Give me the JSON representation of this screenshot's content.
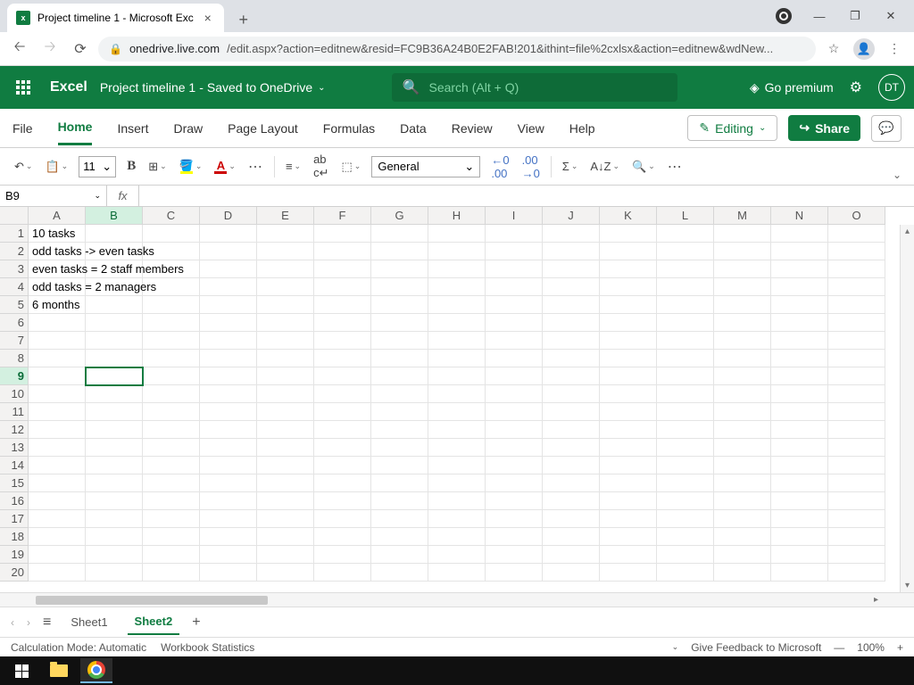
{
  "browser": {
    "tab_title": "Project timeline 1 - Microsoft Exc",
    "url_host": "onedrive.live.com",
    "url_path": "/edit.aspx?action=editnew&resid=FC9B36A24B0E2FAB!201&ithint=file%2cxlsx&action=editnew&wdNew..."
  },
  "header": {
    "app": "Excel",
    "doc_title": "Project timeline 1",
    "save_status": "Saved to OneDrive",
    "search_placeholder": "Search (Alt + Q)",
    "premium": "Go premium",
    "user_initials": "DT"
  },
  "ribbon": {
    "tabs": [
      "File",
      "Home",
      "Insert",
      "Draw",
      "Page Layout",
      "Formulas",
      "Data",
      "Review",
      "View",
      "Help"
    ],
    "active_tab": "Home",
    "editing_label": "Editing",
    "share_label": "Share",
    "font_size": "11",
    "number_format": "General"
  },
  "formula": {
    "name_box": "B9",
    "fx": ""
  },
  "grid": {
    "columns": [
      "A",
      "B",
      "C",
      "D",
      "E",
      "F",
      "G",
      "H",
      "I",
      "J",
      "K",
      "L",
      "M",
      "N",
      "O"
    ],
    "rows": 20,
    "selected": {
      "row": 9,
      "col": "B"
    },
    "cells": {
      "A1": "10 tasks",
      "A2": "odd tasks -> even tasks",
      "A3": "even tasks = 2 staff members",
      "A4": "odd tasks = 2 managers",
      "A5": "6 months"
    }
  },
  "sheets": {
    "tabs": [
      "Sheet1",
      "Sheet2"
    ],
    "active": "Sheet2"
  },
  "status": {
    "calc_mode": "Calculation Mode: Automatic",
    "wb_stats": "Workbook Statistics",
    "feedback": "Give Feedback to Microsoft",
    "zoom": "100%"
  }
}
